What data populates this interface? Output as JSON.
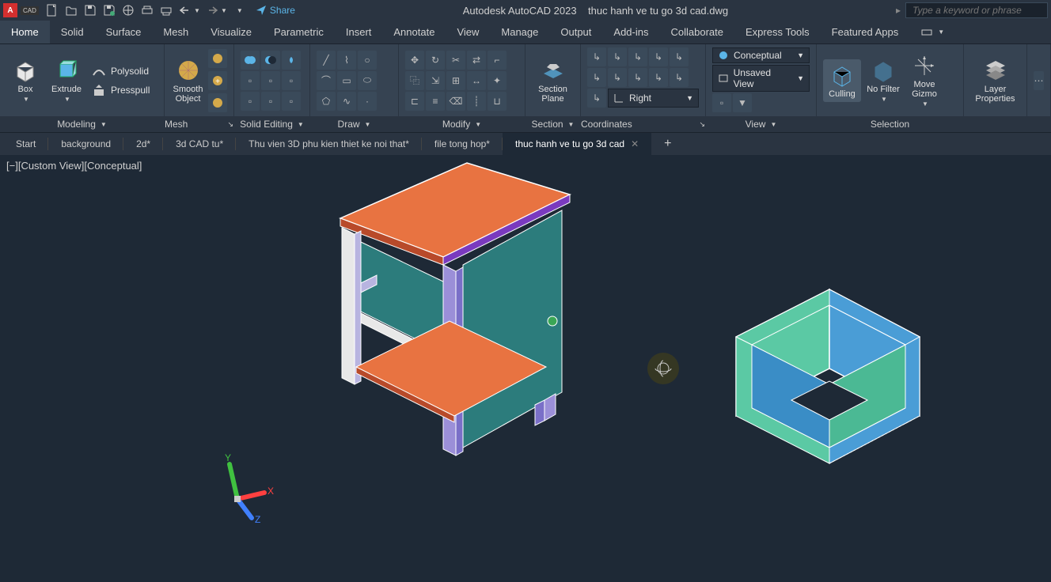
{
  "app": {
    "logo_letter": "A",
    "logo_badge": "CAD",
    "product": "Autodesk AutoCAD 2023",
    "filename": "thuc hanh ve tu go 3d cad.dwg",
    "share": "Share",
    "search_placeholder": "Type a keyword or phrase"
  },
  "menu": {
    "items": [
      "Home",
      "Solid",
      "Surface",
      "Mesh",
      "Visualize",
      "Parametric",
      "Insert",
      "Annotate",
      "View",
      "Manage",
      "Output",
      "Add-ins",
      "Collaborate",
      "Express Tools",
      "Featured Apps"
    ],
    "active": 0
  },
  "ribbon": {
    "modeling": {
      "title": "Modeling",
      "box": "Box",
      "extrude": "Extrude",
      "polysolid": "Polysolid",
      "presspull": "Presspull"
    },
    "mesh": {
      "title": "Mesh",
      "smooth": "Smooth Object"
    },
    "solid_editing": {
      "title": "Solid Editing"
    },
    "draw": {
      "title": "Draw"
    },
    "modify": {
      "title": "Modify"
    },
    "section": {
      "title": "Section",
      "plane": "Section Plane"
    },
    "coordinates": {
      "title": "Coordinates",
      "right": "Right"
    },
    "view": {
      "title": "View",
      "visual_style": "Conceptual",
      "named_view": "Unsaved View"
    },
    "selection": {
      "title": "Selection",
      "culling": "Culling",
      "no_filter": "No Filter",
      "gizmo": "Move Gizmo"
    },
    "layers": {
      "title": "",
      "properties": "Layer Properties"
    }
  },
  "filetabs": [
    {
      "label": "Start",
      "active": false
    },
    {
      "label": "background",
      "active": false
    },
    {
      "label": "2d*",
      "active": false
    },
    {
      "label": "3d CAD tu*",
      "active": false
    },
    {
      "label": "Thu vien 3D phu kien thiet ke noi that*",
      "active": false
    },
    {
      "label": "file tong hop*",
      "active": false
    },
    {
      "label": "thuc hanh ve tu go 3d cad",
      "active": true
    }
  ],
  "viewport": {
    "controls": {
      "minus": "[−]",
      "view": "[Custom View]",
      "style": "[Conceptual]"
    }
  },
  "colors": {
    "orange": "#e87341",
    "teal": "#2c7c7c",
    "purple": "#9b8fd8",
    "white": "#e8e8e8",
    "green_box": "#5bc9a4",
    "blue_box": "#4a9dd6",
    "knob": "#3aa655"
  }
}
